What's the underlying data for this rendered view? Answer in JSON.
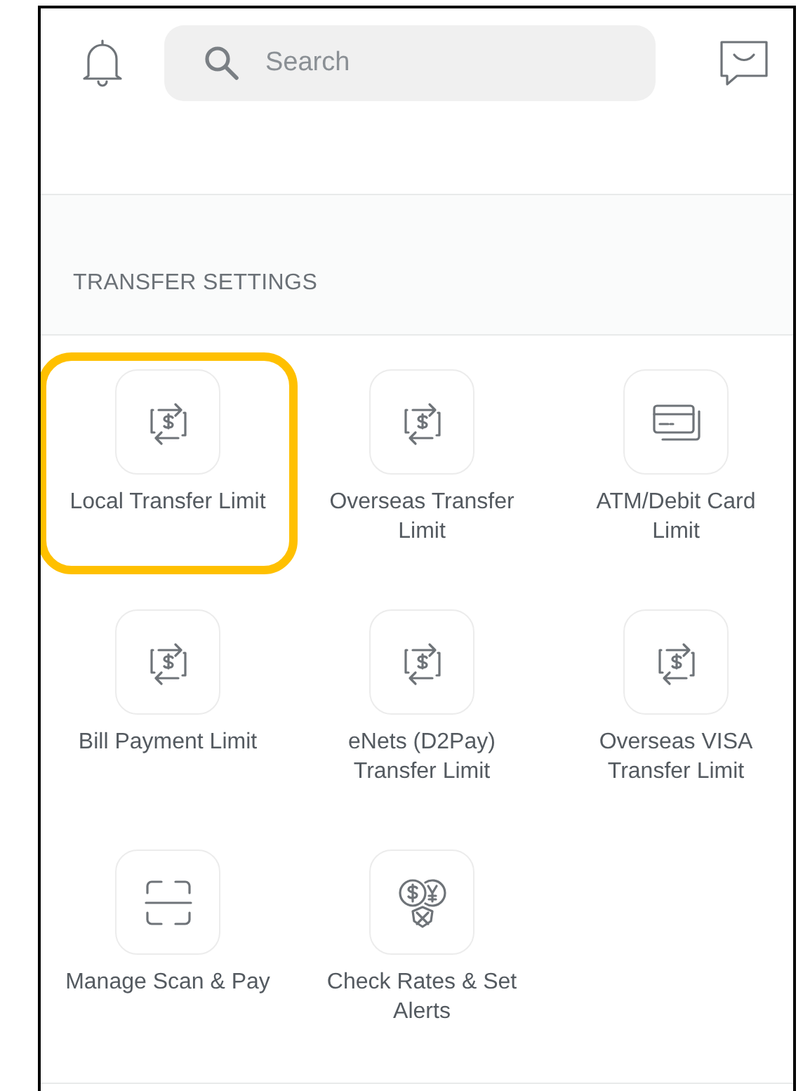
{
  "header": {
    "search": {
      "placeholder": "Search"
    }
  },
  "section": {
    "title": "TRANSFER SETTINGS",
    "items": [
      {
        "label": "Local Transfer Limit",
        "kind": "transfer",
        "highlighted": true
      },
      {
        "label": "Overseas Transfer Limit",
        "kind": "transfer",
        "highlighted": false
      },
      {
        "label": "ATM/Debit Card Limit",
        "kind": "card",
        "highlighted": false
      },
      {
        "label": "Bill Payment Limit",
        "kind": "transfer",
        "highlighted": false
      },
      {
        "label": "eNets (D2Pay) Transfer Limit",
        "kind": "transfer",
        "highlighted": false
      },
      {
        "label": "Overseas VISA Transfer Limit",
        "kind": "transfer",
        "highlighted": false
      },
      {
        "label": "Manage Scan & Pay",
        "kind": "scan",
        "highlighted": false
      },
      {
        "label": "Check Rates & Set Alerts",
        "kind": "rates",
        "highlighted": false
      }
    ]
  }
}
